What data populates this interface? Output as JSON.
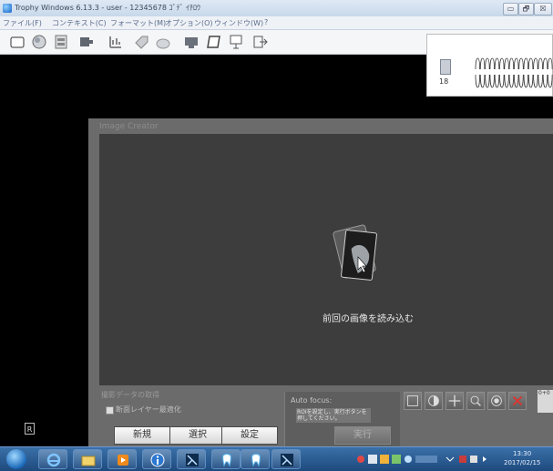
{
  "window": {
    "title": "Trophy Windows 6.13.3 - user - 12345678 ｺﾞﾃﾞ ｲﾁﾛｳ",
    "minimize": "▭",
    "maximize": "🗗",
    "close": "☒"
  },
  "menu": [
    "ファイル(F)",
    "コンテキスト(C)",
    "フォーマット(M)",
    "オプション(O)",
    "ウィンドウ(W)",
    "?"
  ],
  "toolbar": {
    "icons": [
      "new-icon",
      "image-icon",
      "film-icon",
      "device-icon",
      "chart-icon",
      "tag-icon",
      "disk-icon",
      "scanner-icon",
      "screen-icon",
      "panel-icon",
      "exit-icon"
    ]
  },
  "tooth_preview": {
    "tooth_number": "18"
  },
  "image_creator": {
    "title": "Image Creator",
    "load_previous": "前回の画像を読み込む",
    "acquisition_label": "撮影データの取得",
    "merge_label": "断面レイヤー最適化",
    "buttons": {
      "new": "新規",
      "select": "選択",
      "settings": "設定"
    },
    "autofocus": {
      "label": "Auto focus:",
      "description": "ROIを設定し、実行ボタンを押してください。",
      "run": "実行"
    },
    "tools": [
      "rect-select-icon",
      "contrast-icon",
      "crosshair-icon",
      "zoom-icon",
      "record-icon",
      "close-icon"
    ],
    "tool_panel_text": "0+0"
  },
  "r_marker": "R",
  "taskbar": {
    "apps": [
      "ie-icon",
      "explorer-icon",
      "media-icon",
      "info-icon",
      "xray-icon",
      "tooth-app-icon",
      "tooth-app2-icon",
      "xray2-icon"
    ],
    "clock_time": "13:30",
    "clock_date": "2017/02/15"
  }
}
